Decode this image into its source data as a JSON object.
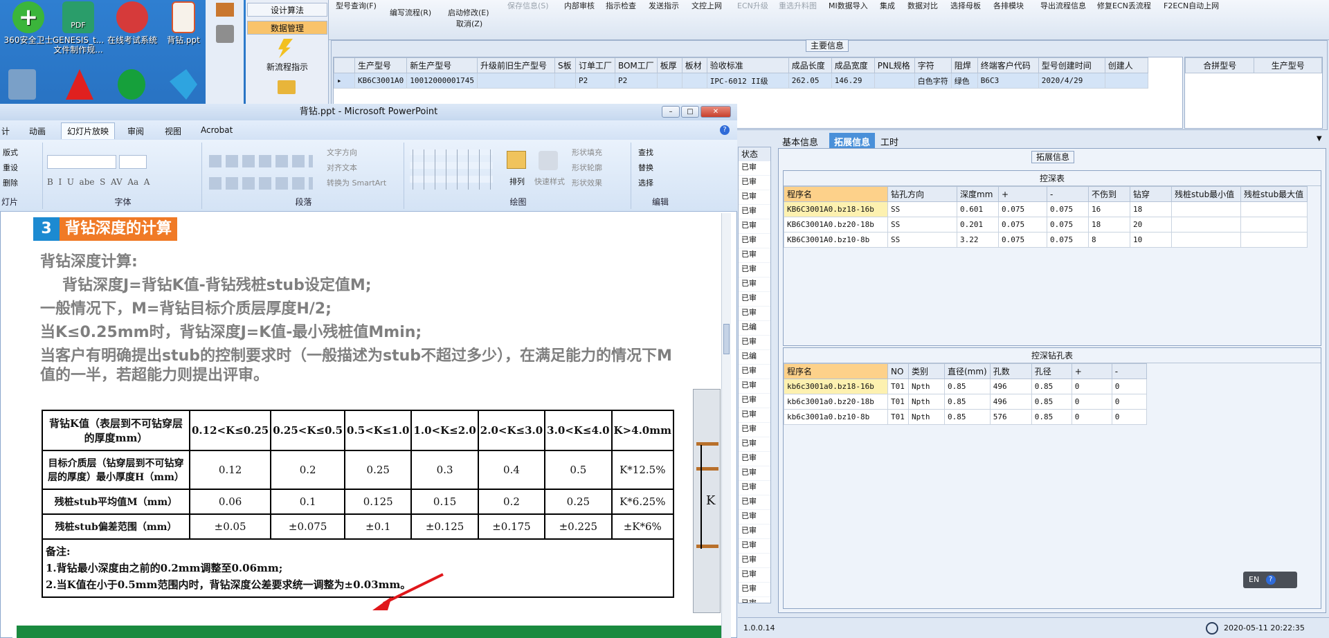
{
  "desktop": {
    "icons": [
      {
        "label": "360安全卫士",
        "icon": "shield-plus-icon",
        "color": "#3bb53b"
      },
      {
        "label": "GENESIS_t... 文件制作规...",
        "icon": "pdf-icon",
        "color": "#2a9d6a"
      },
      {
        "label": "在线考试系统",
        "icon": "chat-icon",
        "color": "#d63a3a"
      },
      {
        "label": "背钻.ppt",
        "icon": "ppt-file-icon",
        "color": "#d8542c"
      }
    ]
  },
  "erp": {
    "nav": {
      "items": [
        "设计算法",
        "数据管理",
        "新流程指示"
      ]
    },
    "toolbar": {
      "items": [
        "型号查询(F)",
        "编写流程(R)",
        "启动修改(E)",
        "取消(Z)",
        "保存信息(S)",
        "内部审核",
        "指示检查",
        "发送指示",
        "文控上网",
        "ECN升级",
        "重选升料图",
        "MI数据导入",
        "集成",
        "数据对比",
        "选择母板",
        "各排模块",
        "导出流程信息",
        "修复ECN丢流程",
        "F2ECN自动上网"
      ]
    },
    "main_info": {
      "title": "主要信息",
      "columns": [
        "生产型号",
        "新生产型号",
        "升级前旧生产型号",
        "S板",
        "订单工厂",
        "BOM工厂",
        "板厚",
        "板材",
        "验收标准",
        "成品长度",
        "成品宽度",
        "PNL规格",
        "字符",
        "阻焊",
        "终端客户代码",
        "型号创建时间",
        "创建人"
      ],
      "row": [
        "KB6C3001A0",
        "10012000001745",
        "",
        "",
        "P2",
        "P2",
        "",
        "",
        "IPC-6012 II级",
        "262.05",
        "146.29",
        "",
        "白色字符",
        "绿色",
        "B6C3",
        "2020/4/29",
        ""
      ]
    },
    "merge": {
      "columns": [
        "合拼型号",
        "生产型号"
      ]
    },
    "status_col": {
      "header": "状态",
      "items": [
        "已审",
        "已审",
        "已审",
        "已审",
        "已审",
        "已审",
        "已审",
        "已审",
        "已审",
        "已审",
        "已审",
        "已编",
        "已审",
        "已编",
        "已审",
        "已审",
        "已审",
        "已审",
        "已审",
        "已审",
        "已审",
        "已审",
        "已审",
        "已审",
        "已审",
        "已审",
        "已审",
        "已审",
        "已审",
        "已审",
        "已审"
      ]
    },
    "tabs": [
      "基本信息",
      "拓展信息",
      "工时"
    ],
    "active_tab": "拓展信息",
    "ext_title": "拓展信息",
    "depth": {
      "title": "控深表",
      "columns": [
        "程序名",
        "钻孔方向",
        "深度mm",
        "+",
        "-",
        "不伤到",
        "钻穿",
        "残桩stub最小值",
        "残桩stub最大值"
      ],
      "rows": [
        [
          "KB6C3001A0.bz18-16b",
          "SS",
          "0.601",
          "0.075",
          "0.075",
          "16",
          "18",
          "",
          ""
        ],
        [
          "KB6C3001A0.bz20-18b",
          "SS",
          "0.201",
          "0.075",
          "0.075",
          "18",
          "20",
          "",
          ""
        ],
        [
          "KB6C3001A0.bz10-8b",
          "SS",
          "3.22",
          "0.075",
          "0.075",
          "8",
          "10",
          "",
          ""
        ]
      ]
    },
    "holes": {
      "title": "控深钻孔表",
      "columns": [
        "程序名",
        "NO",
        "类别",
        "直径(mm)",
        "孔数",
        "孔径",
        "+",
        "-"
      ],
      "rows": [
        [
          "kb6c3001a0.bz18-16b",
          "T01",
          "Npth",
          "0.85",
          "496",
          "0.85",
          "0",
          "0"
        ],
        [
          "kb6c3001a0.bz20-18b",
          "T01",
          "Npth",
          "0.85",
          "496",
          "0.85",
          "0",
          "0"
        ],
        [
          "kb6c3001a0.bz10-8b",
          "T01",
          "Npth",
          "0.85",
          "576",
          "0.85",
          "0",
          "0"
        ]
      ]
    },
    "statusbar": {
      "version": "1.0.0.14",
      "datetime": "2020-05-11 20:22:35"
    },
    "lang": "EN"
  },
  "ppt": {
    "title": "背钻.ppt - Microsoft PowerPoint",
    "tabs": [
      "计",
      "动画",
      "幻灯片放映",
      "审阅",
      "视图",
      "Acrobat"
    ],
    "ribbon": {
      "slides_group": [
        "版式",
        "重设",
        "删除"
      ],
      "slides_label": "灯片",
      "font_label": "字体",
      "para_label": "段落",
      "para_items": [
        "文字方向",
        "对齐文本",
        "转换为 SmartArt"
      ],
      "draw_label": "绘图",
      "arrange": "排列",
      "quick_styles": "快速样式",
      "shape_items": [
        "形状填充",
        "形状轮廓",
        "形状效果"
      ],
      "edit_label": "编辑",
      "edit_items": [
        "查找",
        "替换",
        "选择"
      ]
    },
    "slide": {
      "num": "3",
      "heading": "背钻深度的计算",
      "lines": [
        "背钻深度计算:",
        "背钻深度J=背钻K值-背钻残桩stub设定值M;",
        "一般情况下，M=背钻目标介质层厚度H/2;",
        "当K≤0.25mm时，背钻深度J=K值-最小残桩值Mmin;",
        "当客户有明确提出stub的控制要求时（一般描述为stub不超过多少），在满足能力的情况下M",
        "值的一半，若超能力则提出评审。"
      ],
      "table": {
        "header": [
          "背钻K值（表层到不可钻穿层的厚度mm）",
          "0.12<K≤0.25",
          "0.25<K≤0.5",
          "0.5<K≤1.0",
          "1.0<K≤2.0",
          "2.0<K≤3.0",
          "3.0<K≤4.0",
          "K>4.0mm"
        ],
        "rows": [
          [
            "目标介质层（钻穿层到不可钻穿层的厚度）最小厚度H（mm）",
            "0.12",
            "0.2",
            "0.25",
            "0.3",
            "0.4",
            "0.5",
            "K*12.5%"
          ],
          [
            "残桩stub平均值M（mm）",
            "0.06",
            "0.1",
            "0.125",
            "0.15",
            "0.2",
            "0.25",
            "K*6.25%"
          ],
          [
            "残桩stub偏差范围（mm）",
            "±0.05",
            "±0.075",
            "±0.1",
            "±0.125",
            "±0.175",
            "±0.225",
            "±K*6%"
          ]
        ],
        "notes": [
          "备注:",
          "1.背钻最小深度由之前的0.2mm调整至0.06mm;",
          "2.当K值在小于0.5mm范围内时，背钻深度公差要求统一调整为±0.03mm。"
        ]
      },
      "diagram_label": "K"
    }
  }
}
